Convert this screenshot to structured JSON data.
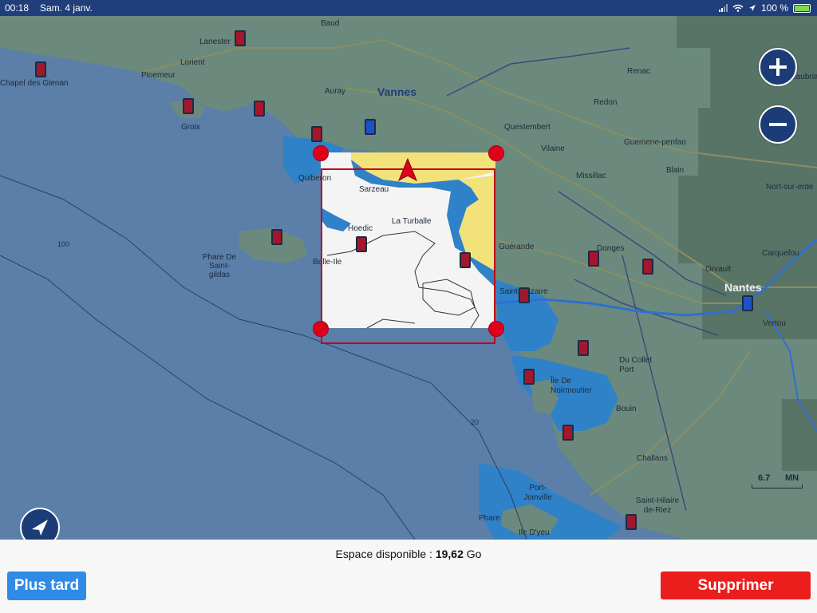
{
  "status_bar": {
    "time": "00:18",
    "date": "Sam. 4 janv.",
    "battery": "100 %",
    "icons": [
      "signal-icon",
      "wifi-icon",
      "location-arrow-icon",
      "battery-charging-icon"
    ]
  },
  "map": {
    "cities": [
      "Vannes",
      "Nantes"
    ],
    "places": [
      "Baud",
      "Lanester",
      "Lorient",
      "Ploemeur",
      "Groix",
      "Auray",
      "Questembert",
      "Vilaine",
      "Missillac",
      "Renac",
      "Redon",
      "Guemene-penfao",
      "Blain",
      "Châteaubriant",
      "Nort-sur-erde",
      "Carquefou",
      "Orvault",
      "Vertou",
      "Donges",
      "Saint-Nazaire",
      "Guérande",
      "La Turballe",
      "Sarzeau",
      "Quiberon",
      "Hoedic",
      "Belle-Ile",
      "Phare De Saint-gildas",
      "Chapel des Glenan",
      "Du Collet Port",
      "Île De Noirmoutier",
      "Bouin",
      "Challans",
      "Saint-Hilaire de-Riez",
      "Port-Joinville",
      "Phare",
      "Ile D'yeu"
    ],
    "depths": [
      "100",
      "20"
    ],
    "scale_value": "6.7",
    "scale_unit": "MN",
    "zoom_in_icon": "plus-icon",
    "zoom_out_icon": "minus-icon",
    "locate_icon": "navigation-arrow-icon",
    "colors": {
      "sea": "#5b7fa9",
      "land": "#6b8a7d",
      "shallow": "#2f82c8",
      "selection_border": "#c0001a",
      "handle": "#e0001b",
      "sand": "#f2e27a"
    }
  },
  "bottom": {
    "space_label": "Espace disponible :",
    "space_value": "19,62",
    "space_unit": "Go",
    "later_button": "Plus tard",
    "delete_button": "Supprimer"
  }
}
